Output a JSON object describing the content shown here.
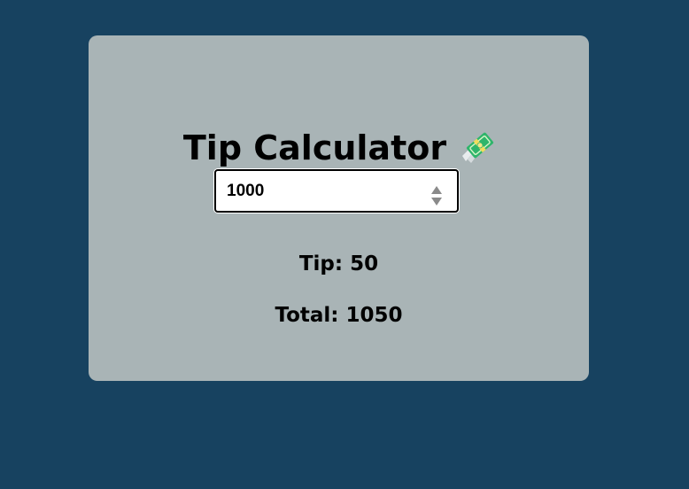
{
  "app": {
    "title": "Tip Calculator",
    "title_icon": "money-with-wings-icon"
  },
  "input": {
    "value": "1000",
    "placeholder": ""
  },
  "results": {
    "tip_label": "Tip:",
    "tip_value": "50",
    "total_label": "Total:",
    "total_value": "1050"
  },
  "colors": {
    "background": "#174260",
    "card": "#a9b4b6",
    "accent_green": "#2fb56b"
  }
}
